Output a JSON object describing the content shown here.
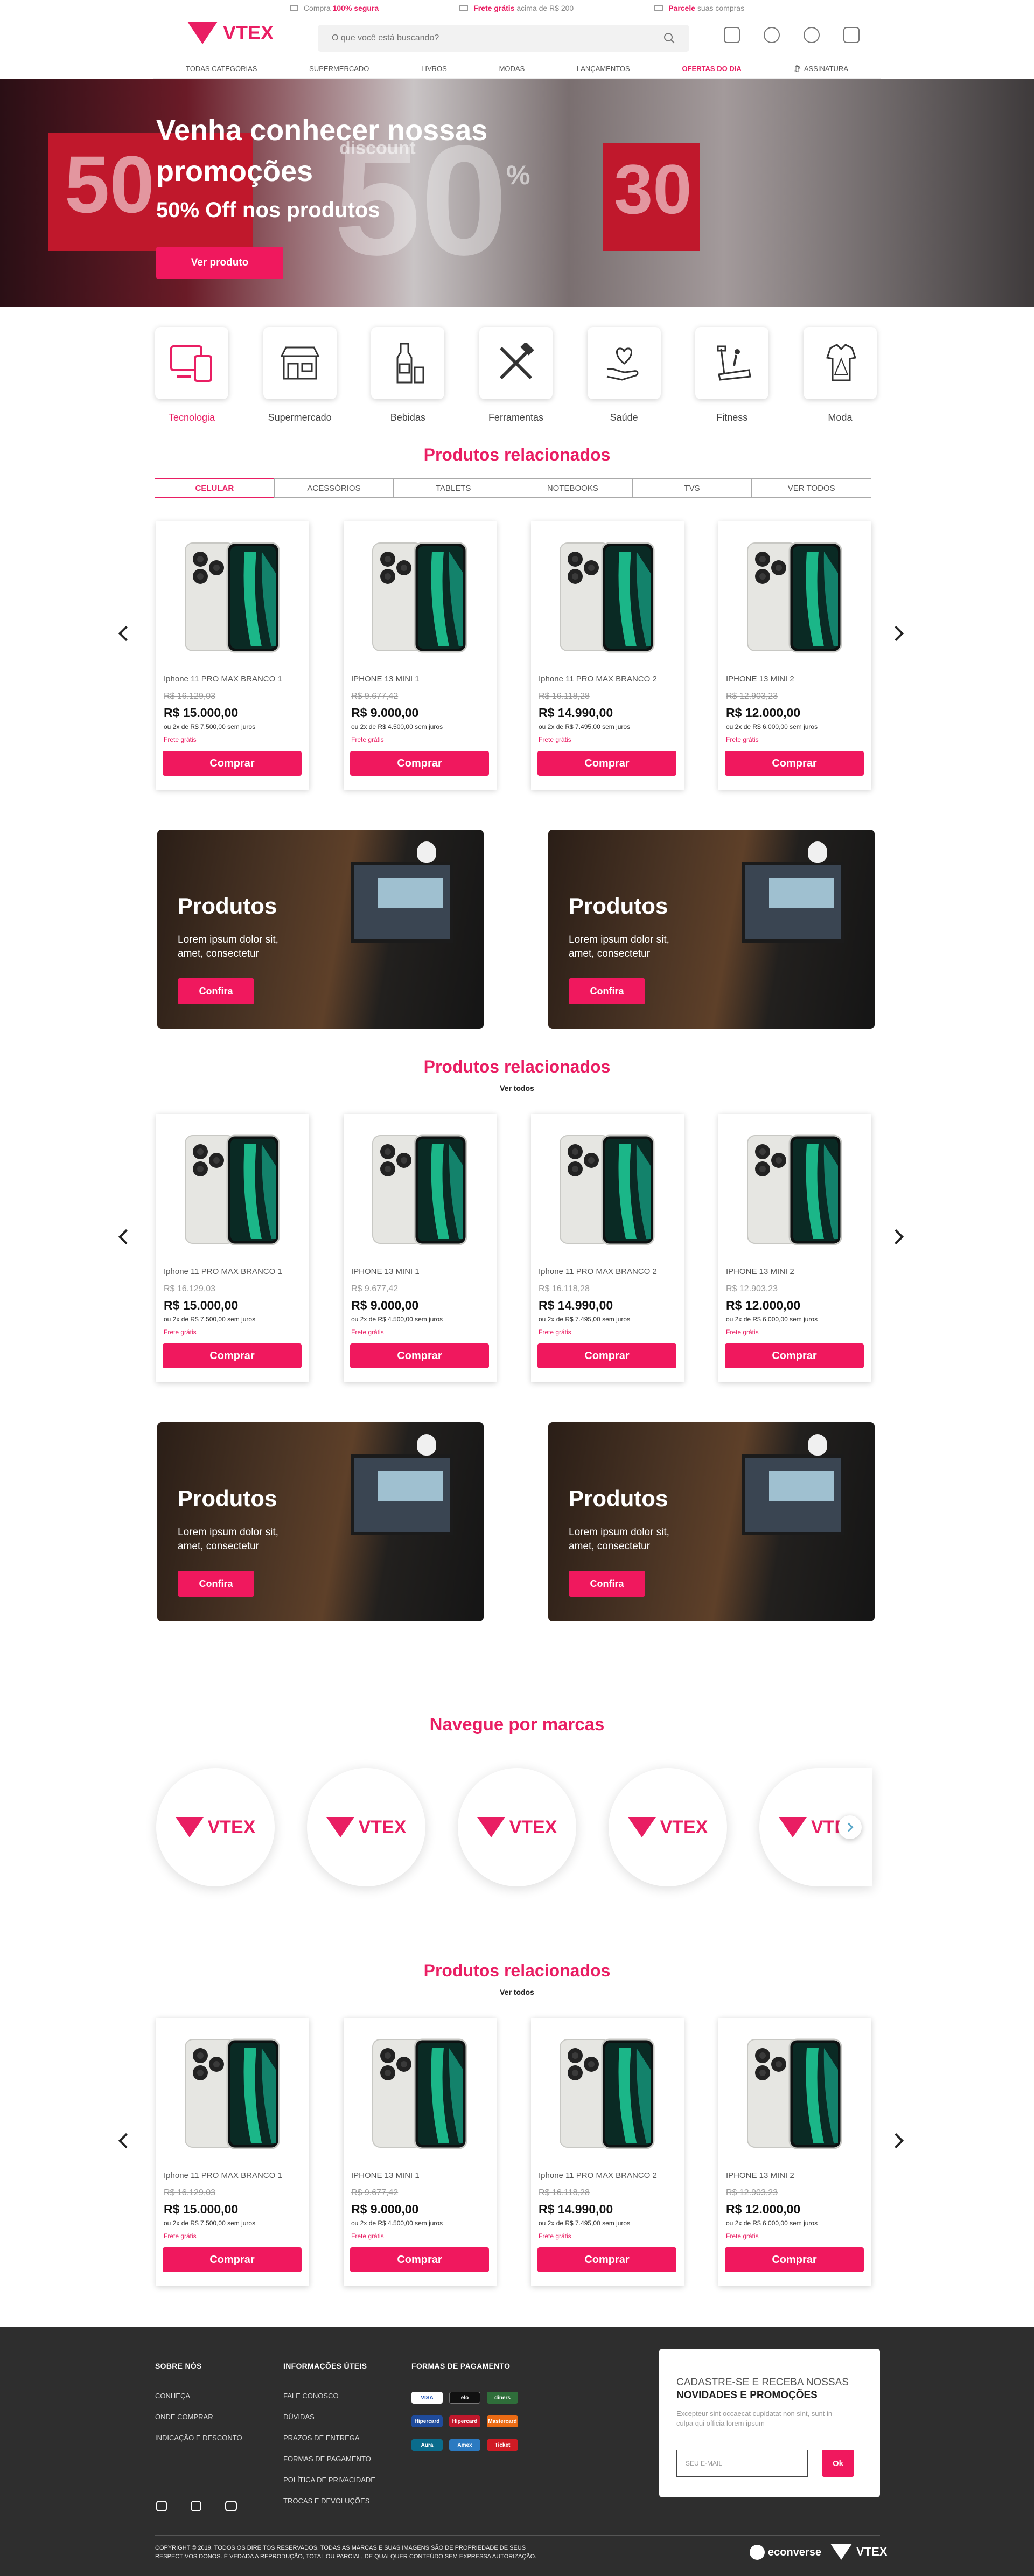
{
  "topbar": {
    "items": [
      {
        "pre": "Compra ",
        "strong": "100% segura",
        "post": ""
      },
      {
        "pre": "",
        "strong": "Frete grátis",
        "post": " acima de R$ 200"
      },
      {
        "pre": "",
        "strong": "Parcele",
        "post": " suas compras"
      }
    ]
  },
  "header": {
    "logo_text": "VTEX",
    "search_placeholder": "O que você está buscando?"
  },
  "nav": [
    "TODAS CATEGORIAS",
    "SUPERMERCADO",
    "LIVROS",
    "MODAS",
    "LANÇAMENTOS",
    "OFERTAS DO DIA",
    "ASSINATURA"
  ],
  "hero": {
    "title": "Venha conhecer nossas promoções",
    "subtitle": "50% Off nos produtos",
    "button": "Ver produto",
    "bg_numbers": [
      "50",
      "50",
      "%",
      "30"
    ],
    "bg_word": "discount"
  },
  "categories": [
    {
      "label": "Tecnologia",
      "icon": "devices-icon"
    },
    {
      "label": "Supermercado",
      "icon": "store-icon"
    },
    {
      "label": "Bebidas",
      "icon": "bottle-icon"
    },
    {
      "label": "Ferramentas",
      "icon": "tools-icon"
    },
    {
      "label": "Saúde",
      "icon": "heart-hand-icon"
    },
    {
      "label": "Fitness",
      "icon": "treadmill-icon"
    },
    {
      "label": "Moda",
      "icon": "clothes-icon"
    }
  ],
  "section_title": "Produtos relacionados",
  "see_all": "Ver todos",
  "tabs": [
    "CELULAR",
    "ACESSÓRIOS",
    "TABLETS",
    "NOTEBOOKS",
    "TVS",
    "VER TODOS"
  ],
  "products": [
    {
      "name": "Iphone 11 PRO MAX BRANCO 1",
      "old": "R$ 16.129,03",
      "price": "R$ 15.000,00",
      "inst": "ou 2x de R$ 7.500,00 sem juros",
      "ship": "Frete grátis",
      "buy": "Comprar"
    },
    {
      "name": "IPHONE 13 MINI 1",
      "old": "R$ 9.677,42",
      "price": "R$ 9.000,00",
      "inst": "ou 2x de R$ 4.500,00 sem juros",
      "ship": "Frete grátis",
      "buy": "Comprar"
    },
    {
      "name": "Iphone 11 PRO MAX BRANCO 2",
      "old": "R$ 16.118,28",
      "price": "R$ 14.990,00",
      "inst": "ou 2x de R$ 7.495,00 sem juros",
      "ship": "Frete grátis",
      "buy": "Comprar"
    },
    {
      "name": "IPHONE 13 MINI 2",
      "old": "R$ 12.903,23",
      "price": "R$ 12.000,00",
      "inst": "ou 2x de R$ 6.000,00 sem juros",
      "ship": "Frete grátis",
      "buy": "Comprar"
    }
  ],
  "promo": {
    "title": "Produtos",
    "text": "Lorem ipsum dolor sit, amet, consectetur",
    "button": "Confira"
  },
  "brands": {
    "title": "Navegue por marcas",
    "logo_text": "VTEX"
  },
  "footer": {
    "about_title": "SOBRE NÓS",
    "about_links": [
      "CONHEÇA",
      "ONDE COMPRAR",
      "INDICAÇÃO E DESCONTO"
    ],
    "info_title": "INFORMAÇÕES ÚTEIS",
    "info_links": [
      "FALE CONOSCO",
      "DÚVIDAS",
      "PRAZOS DE ENTREGA",
      "FORMAS DE PAGAMENTO",
      "POLÍTICA DE PRIVACIDADE",
      "TROCAS E DEVOLUÇÕES"
    ],
    "pay_title": "FORMAS DE PAGAMENTO",
    "payments": [
      "VISA",
      "elo",
      "diners",
      "Hipercard",
      "Hipercard",
      "Mastercard",
      "Aura",
      "Amex",
      "Ticket"
    ],
    "news_line1": "CADASTRE-SE E RECEBA NOSSAS",
    "news_line2": "NOVIDADES E PROMOÇÕES",
    "news_text": "Excepteur sint occaecat cupidatat non sint, sunt in culpa qui officia lorem ipsum",
    "email_placeholder": "SEU E-MAIL",
    "ok": "Ok",
    "copyright": "COPYRIGHT © 2019. TODOS OS DIREITOS RESERVADOS. TODAS AS MARCAS E SUAS IMAGENS SÃO DE PROPRIEDADE DE SEUS RESPECTIVOS DONOS. É VEDADA A REPRODUÇÃO, TOTAL OU PARCIAL, DE QUALQUER CONTEÚDO SEM EXPRESSA AUTORIZAÇÃO.",
    "partner1": "econverse",
    "partner2": "VTEX"
  },
  "colors": {
    "accent": "#e91e63",
    "button": "#f0185e",
    "footer_bg": "#2e2e2e"
  }
}
